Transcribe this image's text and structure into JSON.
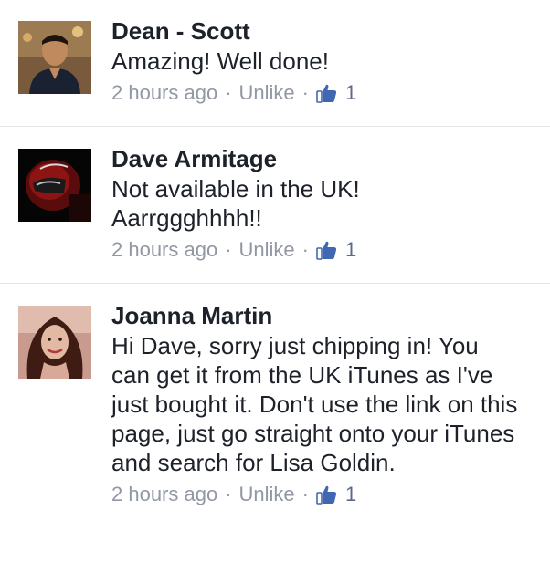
{
  "comments": [
    {
      "name": "Dean - Scott",
      "text": "Amazing! Well done!",
      "time": "2 hours ago",
      "action": "Unlike",
      "like_count": "1",
      "avatar_colors": {
        "bg": "#6b4a32",
        "fg": "#2a1e16",
        "accent": "#d9a36b"
      }
    },
    {
      "name": "Dave Armitage",
      "text": "Not available in the UK! Aarrggghhhh!!",
      "time": "2 hours ago",
      "action": "Unlike",
      "like_count": "1",
      "avatar_colors": {
        "bg": "#0a0a0a",
        "fg": "#7a1010",
        "accent": "#c0c0c0"
      }
    },
    {
      "name": "Joanna Martin",
      "text": "Hi Dave, sorry just chipping in! You can get it from the UK iTunes as I've just bought it. Don't use the link on this page, just go straight onto your iTunes and search for Lisa Goldin.",
      "time": "2 hours ago",
      "action": "Unlike",
      "like_count": "1",
      "avatar_colors": {
        "bg": "#b07a7a",
        "fg": "#3a1a12",
        "accent": "#e8c2b0"
      }
    }
  ],
  "separator": "·",
  "colors": {
    "like_blue": "#4267b2",
    "meta_grey": "#9197a3"
  }
}
